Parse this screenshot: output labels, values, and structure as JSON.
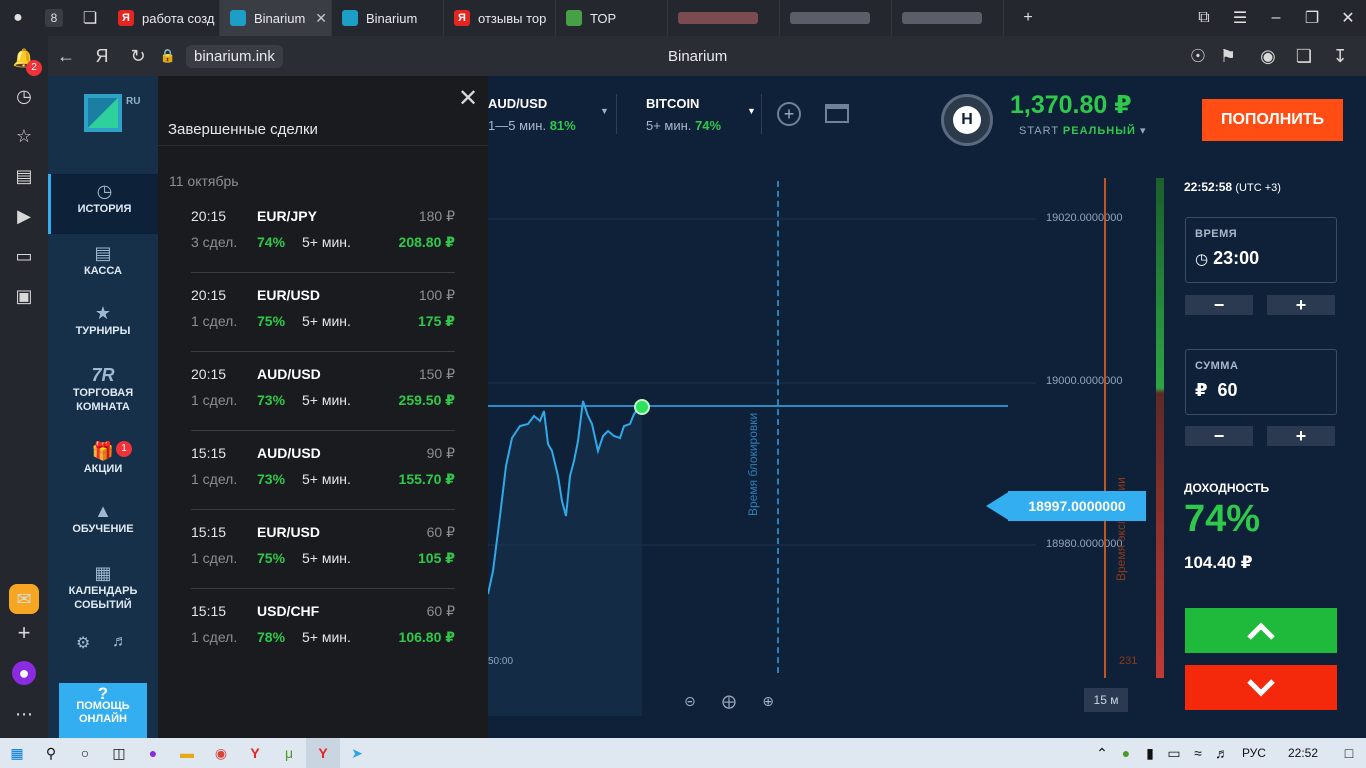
{
  "browser": {
    "profile_count": "8",
    "tabs": [
      {
        "label": "работа созд",
        "fav_color": "#e52620",
        "fav_letter": "Я"
      },
      {
        "label": "Binarium",
        "fav_color": "#1d9ec6",
        "fav_letter": "",
        "active": true
      },
      {
        "label": "Binarium",
        "fav_color": "#1d9ec6",
        "fav_letter": ""
      },
      {
        "label": "отзывы тор",
        "fav_color": "#e52620",
        "fav_letter": "Я"
      },
      {
        "label": "ТОР",
        "fav_color": "#46a046",
        "fav_letter": ""
      }
    ],
    "url": "binarium.ink",
    "page_title": "Binarium",
    "notif_badge": "2"
  },
  "sidebar": {
    "logo_region": "RU",
    "items": [
      {
        "label": "ИСТОРИЯ",
        "icon": "history-icon",
        "active": true
      },
      {
        "label": "КАССА",
        "icon": "wallet-icon"
      },
      {
        "label": "ТУРНИРЫ",
        "icon": "tournament-icon"
      },
      {
        "label": "ТОРГОВАЯ КОМНАТА",
        "icon": "trading-room-icon"
      },
      {
        "label": "АКЦИИ",
        "icon": "gift-icon",
        "badge": "1"
      },
      {
        "label": "ОБУЧЕНИЕ",
        "icon": "education-icon"
      },
      {
        "label": "КАЛЕНДАРЬ СОБЫТИЙ",
        "icon": "calendar-icon"
      }
    ],
    "help_label": "ПОМОЩЬ ОНЛАЙН"
  },
  "history": {
    "title": "Завершенные сделки",
    "date": "11 октябрь",
    "deals": [
      {
        "time": "20:15",
        "pair": "EUR/JPY",
        "amount": "180 ₽",
        "count": "3 сдел.",
        "pct": "74%",
        "duration": "5+ мин.",
        "profit": "208.80 ₽"
      },
      {
        "time": "20:15",
        "pair": "EUR/USD",
        "amount": "100 ₽",
        "count": "1 сдел.",
        "pct": "75%",
        "duration": "5+ мин.",
        "profit": "175 ₽"
      },
      {
        "time": "20:15",
        "pair": "AUD/USD",
        "amount": "150 ₽",
        "count": "1 сдел.",
        "pct": "73%",
        "duration": "5+ мин.",
        "profit": "259.50 ₽"
      },
      {
        "time": "15:15",
        "pair": "AUD/USD",
        "amount": "90 ₽",
        "count": "1 сдел.",
        "pct": "73%",
        "duration": "5+ мин.",
        "profit": "155.70 ₽"
      },
      {
        "time": "15:15",
        "pair": "EUR/USD",
        "amount": "60 ₽",
        "count": "1 сдел.",
        "pct": "75%",
        "duration": "5+ мин.",
        "profit": "105 ₽"
      },
      {
        "time": "15:15",
        "pair": "USD/CHF",
        "amount": "60 ₽",
        "count": "1 сдел.",
        "pct": "78%",
        "duration": "5+ мин.",
        "profit": "106.80 ₽"
      }
    ]
  },
  "assets": [
    {
      "name": "AUD/USD",
      "sub": "1—5 мин.",
      "pct": "81%"
    },
    {
      "name": "BITCOIN",
      "sub": "5+ мин.",
      "pct": "74%"
    }
  ],
  "account": {
    "balance": "1,370.80 ₽",
    "level": "START",
    "mode": "РЕАЛЬНЫЙ",
    "level_icon_letter": "H",
    "deposit_label": "ПОПОЛНИТЬ"
  },
  "chart": {
    "y_ticks": [
      "19020.0000000",
      "19000.0000000",
      "18980.0000000"
    ],
    "current_price": "18997.0000000",
    "lock_label": "Время блокировки",
    "expiry_label": "Время экспирации",
    "left_tick": "50:00",
    "right_tick": "231",
    "timeframe": "15 м"
  },
  "trade": {
    "clock": "22:52:58",
    "tz": "(UTC +3)",
    "time_label": "ВРЕМЯ",
    "time_value": "23:00",
    "amount_label": "СУММА",
    "amount_currency": "₽",
    "amount_value": "60",
    "yield_label": "ДОХОДНОСТЬ",
    "yield_pct": "74%",
    "yield_amount": "104.40 ₽"
  },
  "taskbar": {
    "lang": "РУС",
    "time": "22:52"
  }
}
